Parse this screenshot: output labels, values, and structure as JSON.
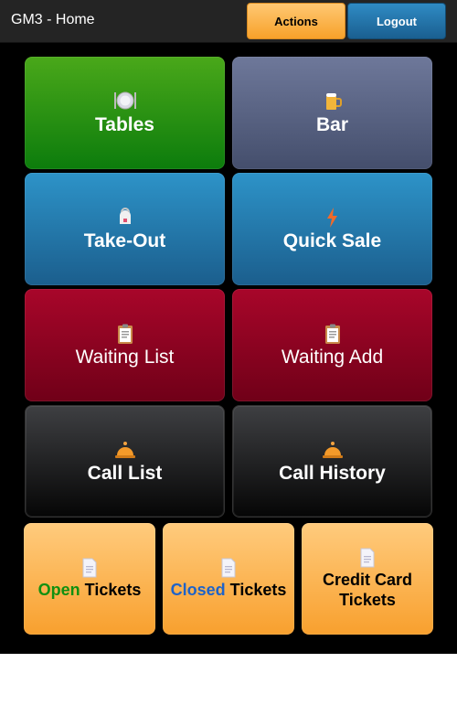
{
  "header": {
    "title": "GM3 - Home",
    "actions_label": "Actions",
    "logout_label": "Logout"
  },
  "tiles": {
    "tables": {
      "label": "Tables",
      "icon": "plate-icon"
    },
    "bar": {
      "label": "Bar",
      "icon": "beer-mug-icon"
    },
    "takeout": {
      "label": "Take-Out",
      "icon": "takeout-icon"
    },
    "quicksale": {
      "label": "Quick Sale",
      "icon": "lightning-icon"
    },
    "waitinglist": {
      "label": "Waiting List",
      "icon": "clipboard-icon"
    },
    "waitingadd": {
      "label": "Waiting Add",
      "icon": "clipboard-icon"
    },
    "calllist": {
      "label": "Call List",
      "icon": "bell-icon"
    },
    "callhistory": {
      "label": "Call History",
      "icon": "bell-icon"
    }
  },
  "tickets": {
    "open_prefix": "Open",
    "open_suffix": "Tickets",
    "closed_prefix": "Closed",
    "closed_suffix": "Tickets",
    "credit_line1": "Credit Card",
    "credit_line2": "Tickets",
    "icon": "document-icon"
  },
  "colors": {
    "green_tile": "#2a9216",
    "slate_tile": "#5b6585",
    "blue_tile": "#2478ad",
    "red_tile": "#8c0322",
    "dark_tile": "#222222",
    "orange_tile": "#fbb552",
    "open_word": "#109010",
    "closed_word": "#1e63c8"
  }
}
